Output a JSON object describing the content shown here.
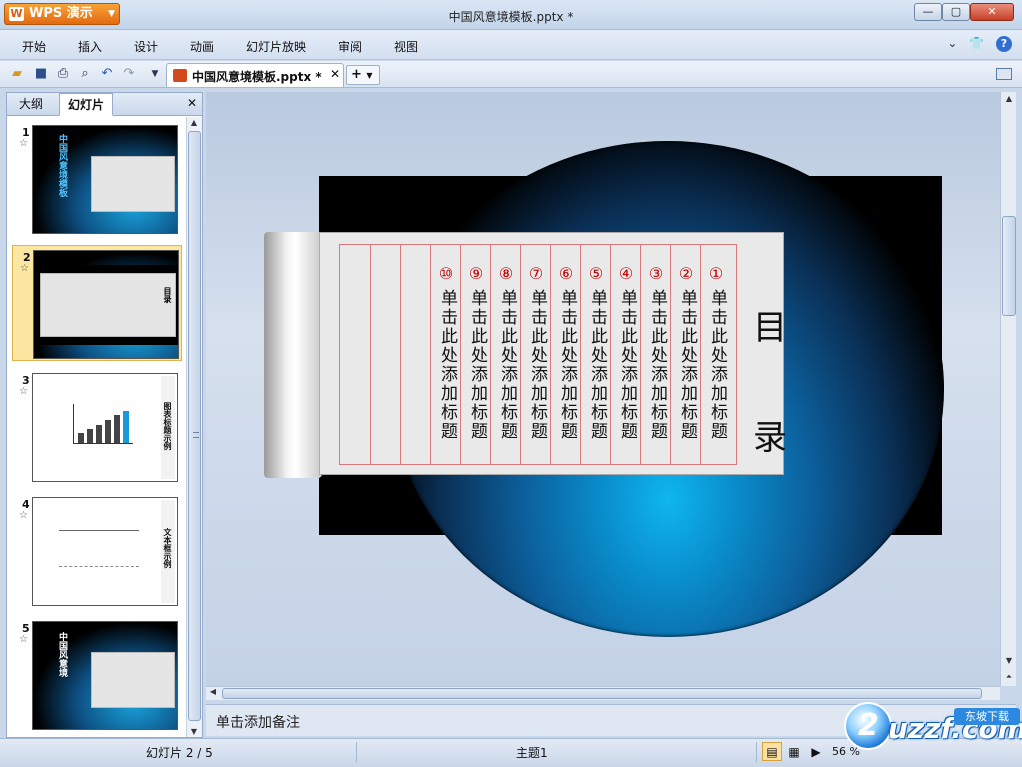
{
  "app": {
    "name": "WPS 演示",
    "window_title": "中国风意境模板.pptx *"
  },
  "menu": [
    "开始",
    "插入",
    "设计",
    "动画",
    "幻灯片放映",
    "审阅",
    "视图"
  ],
  "doc_tab": {
    "name": "中国风意境模板.pptx *"
  },
  "panel": {
    "tab_outline": "大纲",
    "tab_slides": "幻灯片",
    "selected_slide": 2
  },
  "thumbnails": [
    {
      "number": "1",
      "text": "中国风意境模板"
    },
    {
      "number": "2",
      "text": "目录"
    },
    {
      "number": "3",
      "text": "图表标题示例"
    },
    {
      "number": "4",
      "text": "文本框示例"
    },
    {
      "number": "5",
      "text": "中国风意境"
    }
  ],
  "slide": {
    "title_char_1": "目",
    "title_char_2": "录",
    "items": [
      {
        "num": "①",
        "label": "单击此处添加标题"
      },
      {
        "num": "②",
        "label": "单击此处添加标题"
      },
      {
        "num": "③",
        "label": "单击此处添加标题"
      },
      {
        "num": "④",
        "label": "单击此处添加标题"
      },
      {
        "num": "⑤",
        "label": "单击此处添加标题"
      },
      {
        "num": "⑥",
        "label": "单击此处添加标题"
      },
      {
        "num": "⑦",
        "label": "单击此处添加标题"
      },
      {
        "num": "⑧",
        "label": "单击此处添加标题"
      },
      {
        "num": "⑨",
        "label": "单击此处添加标题"
      },
      {
        "num": "⑩",
        "label": "单击此处添加标题"
      }
    ]
  },
  "notes_placeholder": "单击添加备注",
  "status": {
    "slide_info": "幻灯片 2 / 5",
    "theme": "主题1",
    "zoom": "56 %"
  },
  "watermark": {
    "text": "uzzf.com",
    "tag": "东坡下载"
  },
  "colors": {
    "accent": "#e26a10",
    "item_number": "#c00000",
    "glow": "#0fb6ef"
  }
}
